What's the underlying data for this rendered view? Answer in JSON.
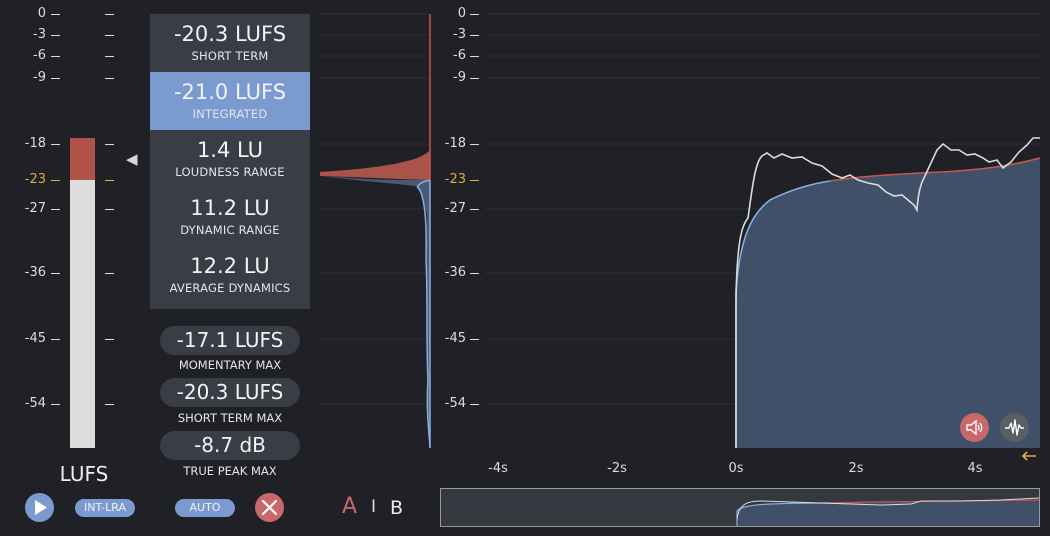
{
  "meter": {
    "scale_labels": [
      "0",
      "-3",
      "-6",
      "-9",
      "-18",
      "-23",
      "-27",
      "-36",
      "-45",
      "-54"
    ],
    "target_label": "-23",
    "unit": "LUFS",
    "level_fill_fraction": 1.0,
    "above_target_color": "#b0544a",
    "below_target_color": "#dcdcdc"
  },
  "readouts": [
    {
      "value": "-20.3 LUFS",
      "label": "SHORT TERM",
      "active": false
    },
    {
      "value": "-21.0 LUFS",
      "label": "INTEGRATED",
      "active": true
    },
    {
      "value": "1.4 LU",
      "label": "LOUDNESS RANGE",
      "active": false
    },
    {
      "value": "11.2 LU",
      "label": "DYNAMIC RANGE",
      "active": false
    },
    {
      "value": "12.2 LU",
      "label": "AVERAGE DYNAMICS",
      "active": false
    }
  ],
  "maxima": [
    {
      "value": "-17.1 LUFS",
      "label": "MOMENTARY MAX"
    },
    {
      "value": "-20.3 LUFS",
      "label": "SHORT TERM MAX"
    },
    {
      "value": "-8.7 dB",
      "label": "TRUE PEAK MAX"
    }
  ],
  "controls": {
    "play_icon": "play-icon",
    "int_lra_label": "INT-LRA",
    "auto_label": "AUTO",
    "reset_icon": "close-icon",
    "a_label": "A",
    "separator": "I",
    "b_label": "B"
  },
  "graph": {
    "scale_labels": [
      "0",
      "-3",
      "-6",
      "-9",
      "-18",
      "-23",
      "-27",
      "-36",
      "-45",
      "-54"
    ],
    "x_labels": [
      "-4s",
      "-2s",
      "0s",
      "2s",
      "4s"
    ],
    "speaker_icon": "speaker-icon",
    "waveform_icon": "waveform-icon",
    "scroll_icon": "arrow-left-icon"
  },
  "colors": {
    "accent_blue": "#7b9bd0",
    "accent_red": "#c9686a",
    "target_orange": "#e8a843",
    "background": "#1f2126",
    "panel": "#3a3d45"
  }
}
